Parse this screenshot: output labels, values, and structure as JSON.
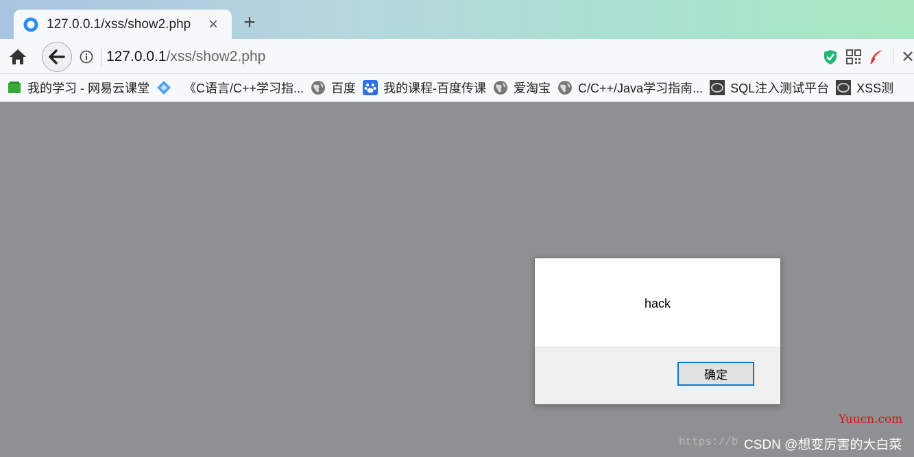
{
  "browser": {
    "tab": {
      "title": "127.0.0.1/xss/show2.php",
      "close_icon": "×"
    },
    "new_tab_icon": "+",
    "address": {
      "host": "127.0.0.1",
      "path": "/xss/show2.php"
    },
    "close_icon": "✕"
  },
  "bookmarks": [
    {
      "label": "我的学习 - 网易云课堂",
      "icon": "green-book-icon"
    },
    {
      "label": "",
      "icon": "diamond-icon"
    },
    {
      "label": "《C语言/C++学习指...",
      "icon": ""
    },
    {
      "label": "百度",
      "icon": "globe-icon"
    },
    {
      "label": "我的课程-百度传课",
      "icon": "baidu-paw-icon"
    },
    {
      "label": "爱淘宝",
      "icon": "globe-icon"
    },
    {
      "label": "C/C++/Java学习指南...",
      "icon": "globe-icon"
    },
    {
      "label": "SQL注入测试平台",
      "icon": "dark-square-icon"
    },
    {
      "label": "XSS测",
      "icon": "dark-square-icon"
    }
  ],
  "dialog": {
    "message": "hack",
    "ok_label": "确定"
  },
  "watermarks": {
    "site": "Yuucn.com",
    "url_partial": "https://b",
    "csdn": "CSDN @想变厉害的大白菜"
  },
  "colors": {
    "dialog_button_border": "#0078d7",
    "watermark_red": "#e01010"
  }
}
